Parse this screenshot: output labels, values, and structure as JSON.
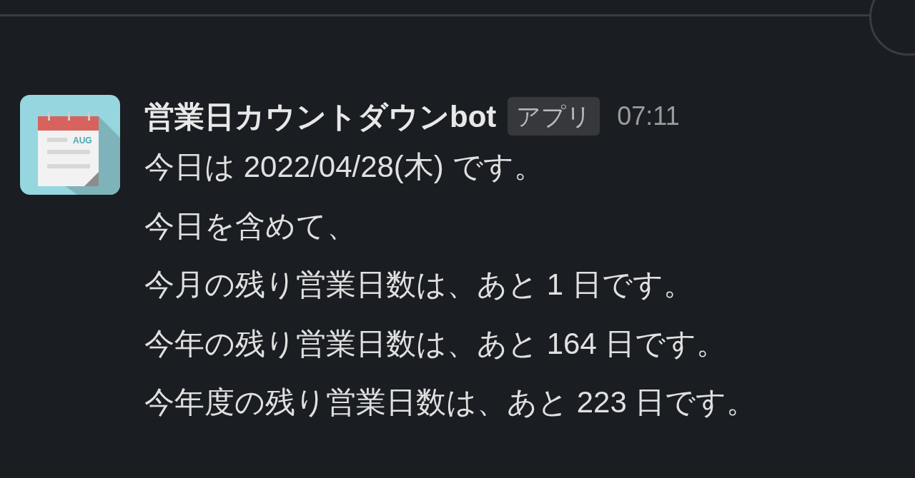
{
  "message": {
    "avatar": {
      "label": "AUG"
    },
    "sender": "営業日カウントダウンbot",
    "badge": "アプリ",
    "time": "07:11",
    "lines": [
      "今日は 2022/04/28(木) です。",
      "今日を含めて、",
      "今月の残り営業日数は、あと 1 日です。",
      "今年の残り営業日数は、あと 164 日です。",
      "今年度の残り営業日数は、あと 223 日です。"
    ]
  }
}
